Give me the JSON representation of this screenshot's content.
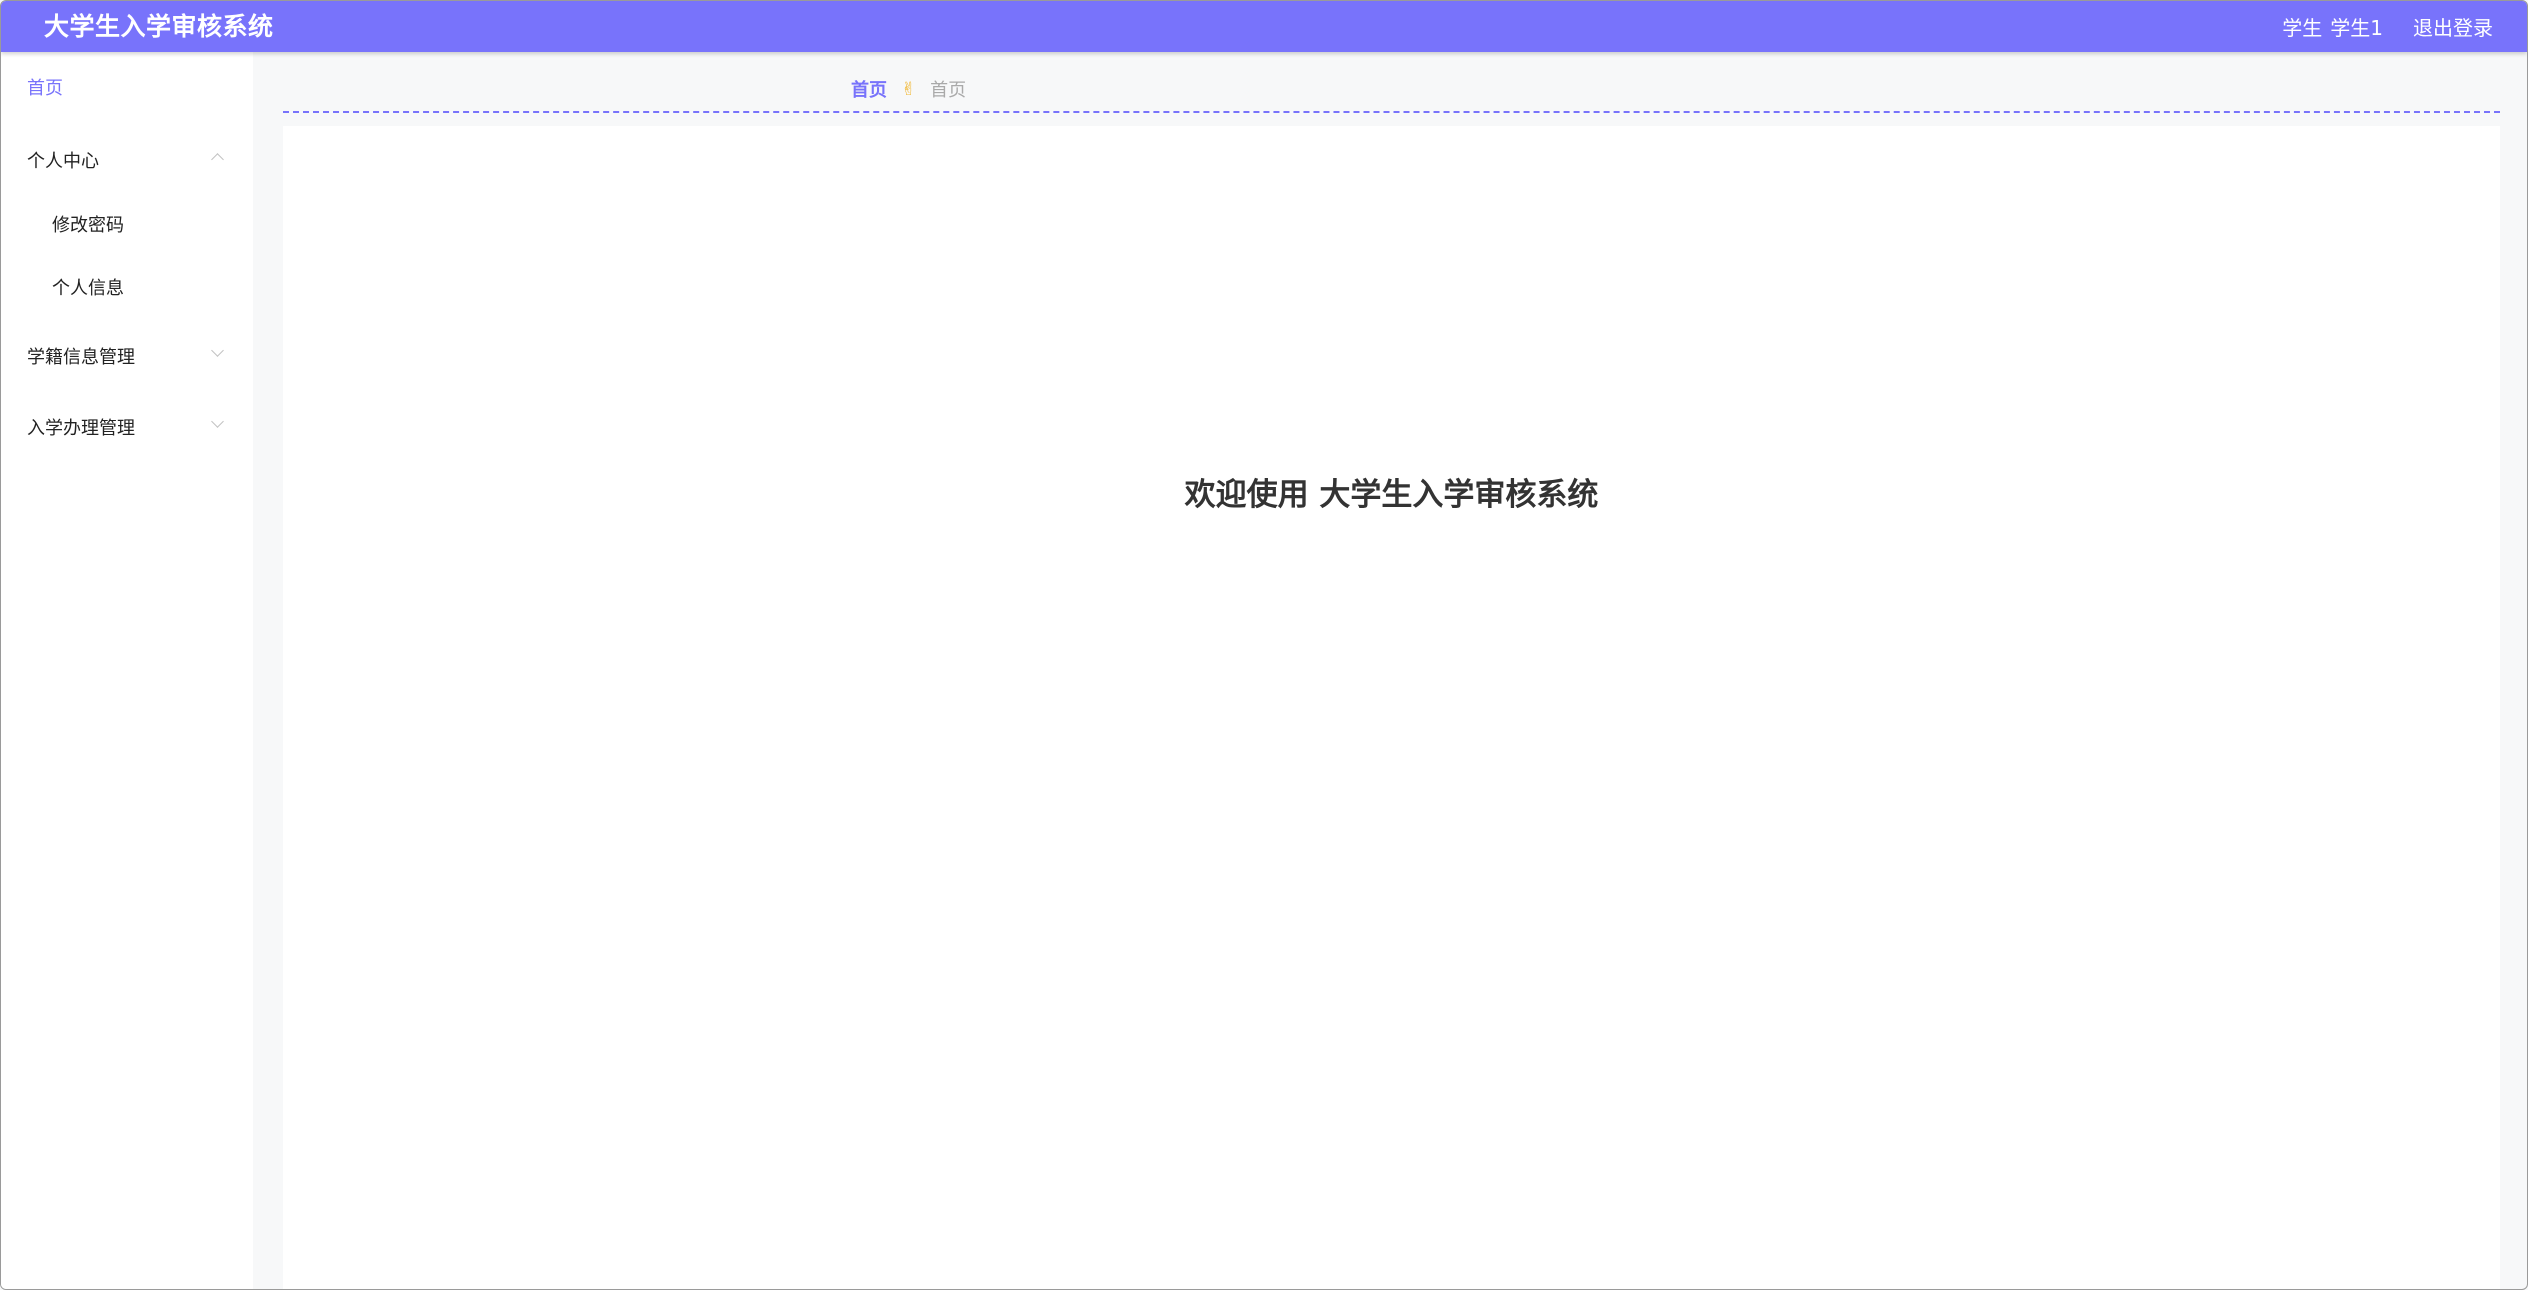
{
  "header": {
    "title": "大学生入学审核系统",
    "role": "学生",
    "username": "学生1",
    "logout_label": "退出登录"
  },
  "sidebar": {
    "items": [
      {
        "label": "首页"
      },
      {
        "label": "个人中心",
        "children": [
          "修改密码",
          "个人信息"
        ],
        "expanded": true
      },
      {
        "label": "学籍信息管理",
        "expanded": false
      },
      {
        "label": "入学办理管理",
        "expanded": false
      }
    ]
  },
  "breadcrumb": {
    "home": "首页",
    "separator": "✌",
    "current": "首页"
  },
  "main": {
    "welcome": "欢迎使用 大学生入学审核系统"
  },
  "colors": {
    "accent": "#7873fb",
    "separator_icon": "#f1b62f",
    "page_bg": "#f7f8f9"
  },
  "icons": {
    "expand": "chevron-up-icon",
    "collapse": "chevron-down-icon",
    "breadcrumb_separator": "victory-hand-icon"
  }
}
